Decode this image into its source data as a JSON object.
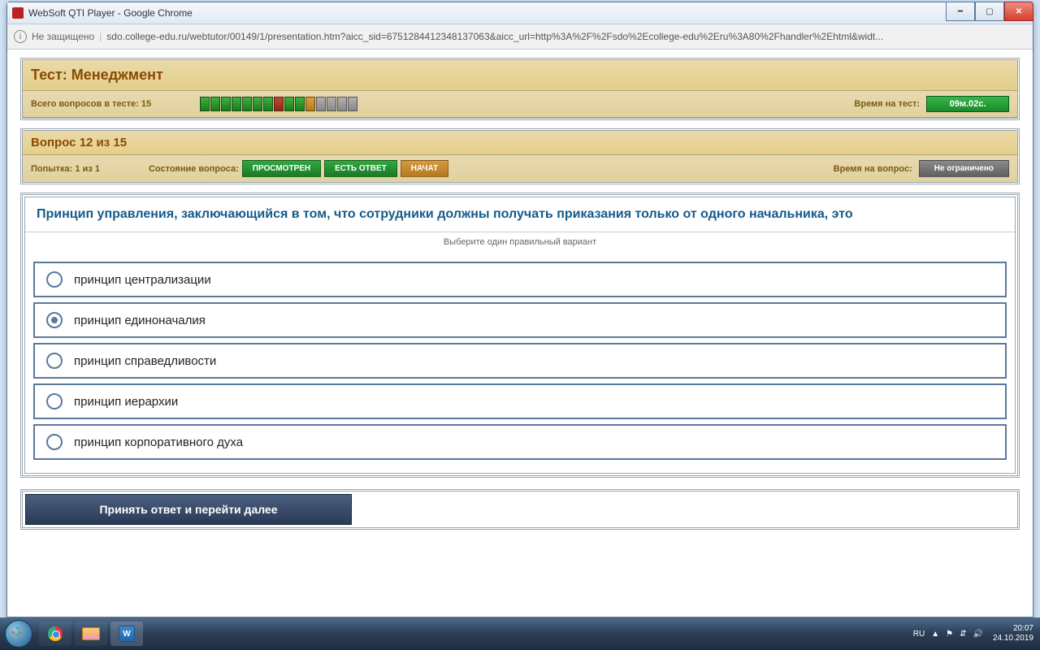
{
  "window": {
    "title": "WebSoft QTI Player - Google Chrome"
  },
  "addressbar": {
    "security_label": "Не защищено",
    "url": "sdo.college-edu.ru/webtutor/00149/1/presentation.htm?aicc_sid=6751284412348137063&aicc_url=http%3A%2F%2Fsdo%2Ecollege-edu%2Eru%3A80%2Fhandler%2Ehtml&widt..."
  },
  "test": {
    "title": "Тест: Менеджмент",
    "total_label": "Всего вопросов в тесте: 15",
    "time_label": "Время на тест:",
    "time_value": "09м.02с.",
    "progress_states": [
      "g",
      "g",
      "g",
      "g",
      "g",
      "g",
      "g",
      "r",
      "g",
      "g",
      "o",
      "gr",
      "gr",
      "gr",
      "gr"
    ]
  },
  "question": {
    "number_label": "Вопрос 12 из 15",
    "attempt_label": "Попытка: 1 из 1",
    "state_label": "Состояние вопроса:",
    "badge_viewed": "ПРОСМОТРЕН",
    "badge_answered": "ЕСТЬ ОТВЕТ",
    "badge_started": "НАЧАТ",
    "qtime_label": "Время на вопрос:",
    "qtime_value": "Не ограничено",
    "text": "Принцип управления, заключающийся в том, что сотрудники должны получать приказания только от одного начальника, это",
    "hint": "Выберите один правильный вариант",
    "options": [
      "принцип централизации",
      "принцип единоначалия",
      "принцип справедливости",
      "принцип иерархии",
      "принцип корпоративного духа"
    ],
    "selected_index": 1,
    "submit_label": "Принять ответ и перейти далее"
  },
  "tray": {
    "lang": "RU",
    "time": "20:07",
    "date": "24.10.2019"
  }
}
